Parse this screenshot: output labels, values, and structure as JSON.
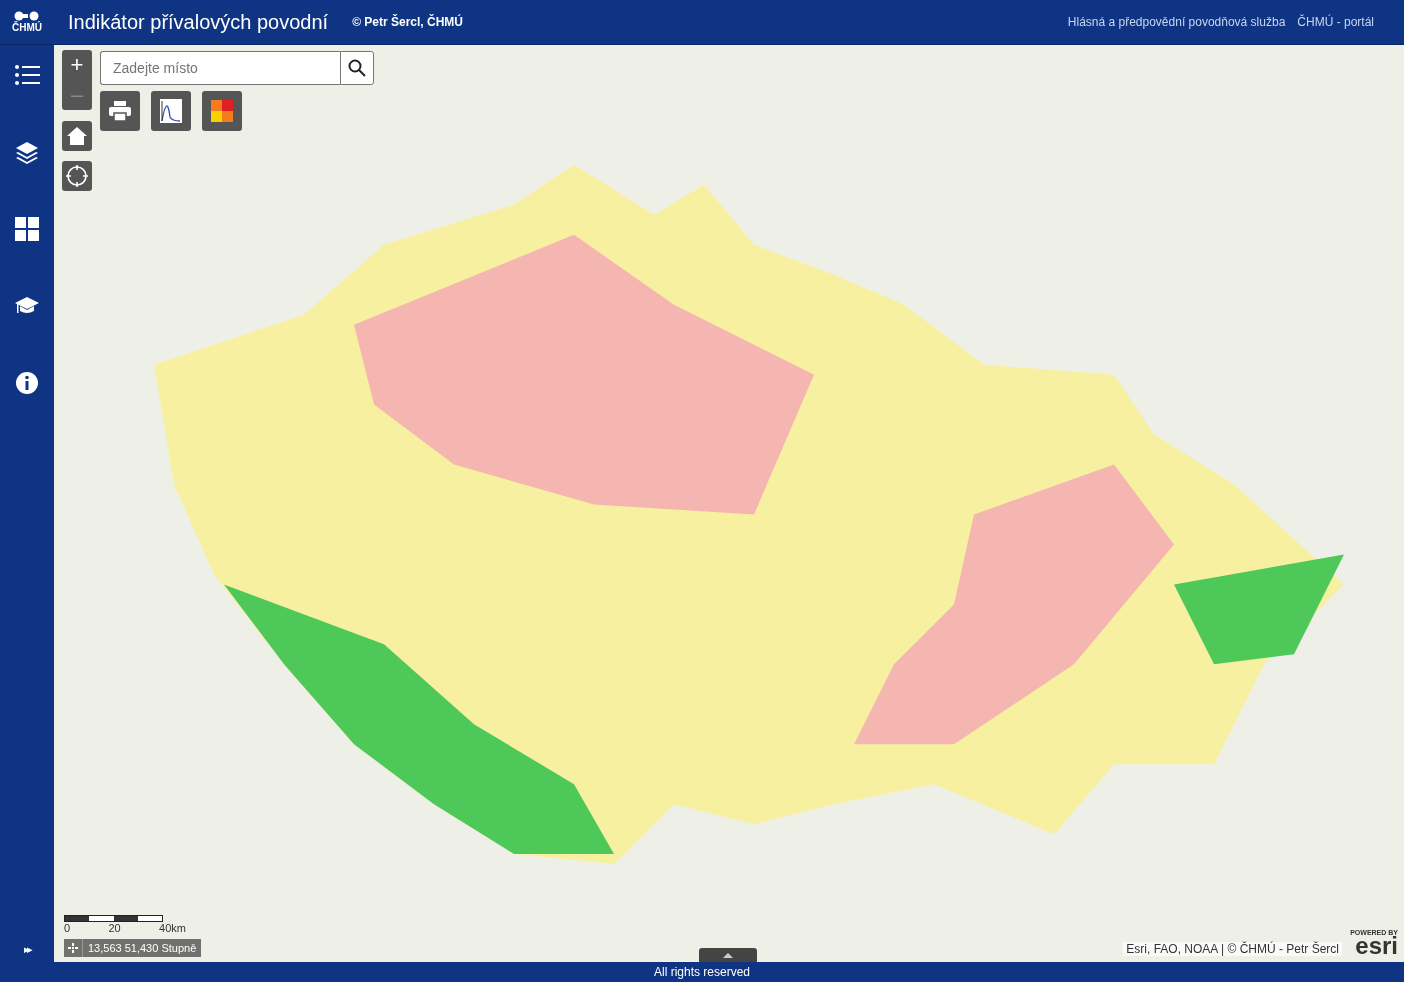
{
  "header": {
    "logo": "ČHMÚ",
    "title": "Indikátor přívalových povodní",
    "credit": "© Petr Šercl, ČHMÚ",
    "links": [
      "Hlásná a předpovědní povodňová služba",
      "ČHMÚ - portál"
    ]
  },
  "sidebar": {
    "items": [
      {
        "kind": "list"
      },
      {
        "kind": "layers"
      },
      {
        "kind": "grid"
      },
      {
        "kind": "education"
      },
      {
        "kind": "info"
      }
    ],
    "expand": "▸▸"
  },
  "map": {
    "zoom_in": "+",
    "zoom_out": "–",
    "search": {
      "placeholder": "Zadejte místo"
    },
    "tools": [
      {
        "kind": "print"
      },
      {
        "kind": "chart"
      },
      {
        "kind": "legend"
      }
    ],
    "scale": {
      "ticks": [
        "0",
        "20",
        "40km"
      ]
    },
    "coordinates": "13,563 51,430 Stupně",
    "attribution": "Esri, FAO, NOAA | © ČHMÚ - Petr Šercl",
    "powered_by": "POWERED BY",
    "brand": "esri"
  },
  "footer": "All rights reserved"
}
